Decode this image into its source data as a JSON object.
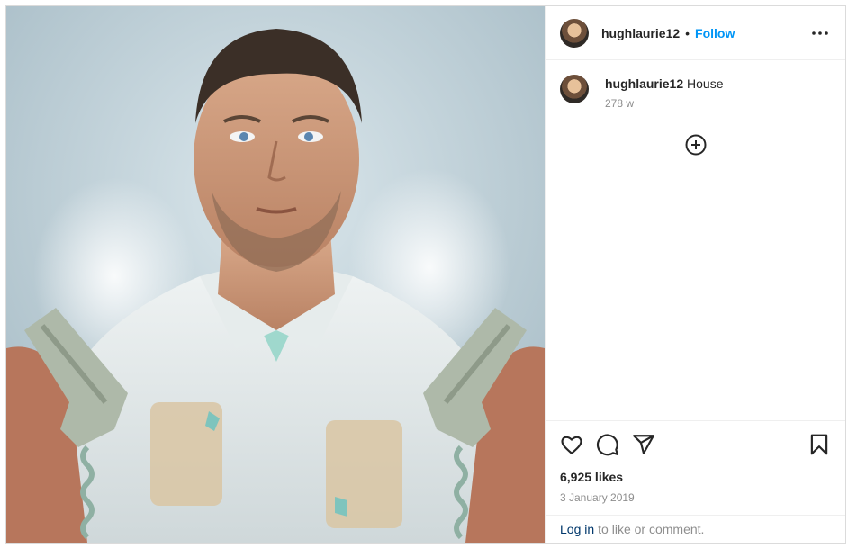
{
  "post": {
    "username": "hughlaurie12",
    "separator": "•",
    "follow_label": "Follow",
    "more_icon": "more-horizontal-icon",
    "caption": {
      "username": "hughlaurie12",
      "text": "House",
      "age": "278 w"
    },
    "load_more_icon": "plus-circle-icon",
    "actions": {
      "like_icon": "heart-icon",
      "comment_icon": "comment-icon",
      "share_icon": "send-icon",
      "save_icon": "bookmark-icon"
    },
    "likes": "6,925 likes",
    "date": "3 January 2019",
    "login": {
      "link": "Log in",
      "text": "to like or comment."
    }
  },
  "colors": {
    "accent": "#0095f6",
    "muted": "#8e8e8e",
    "border": "#dbdbdb",
    "login_link": "#00376b"
  }
}
